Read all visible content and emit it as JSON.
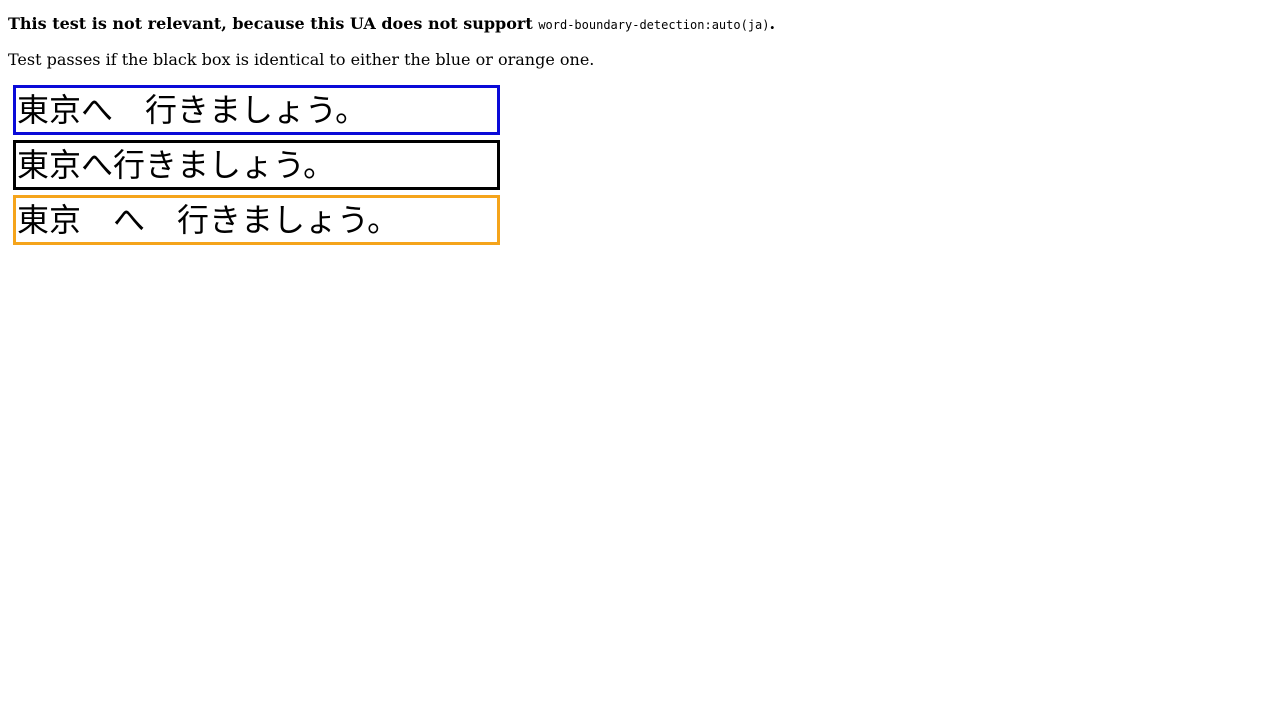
{
  "notice": {
    "prefix": "This test is not relevant, because this UA does not support ",
    "code": "word-boundary-detection:auto(ja)",
    "suffix": "."
  },
  "instructions": "Test passes if the black box is identical to either the blue or orange one.",
  "boxes": {
    "blue": {
      "text": "東京へ　行きましょう。",
      "color": "#0a0ad8"
    },
    "black": {
      "text": "東京へ行きましょう。",
      "color": "#000000"
    },
    "orange": {
      "text": "東京　へ　行きましょう。",
      "color": "#f5a41b"
    }
  }
}
